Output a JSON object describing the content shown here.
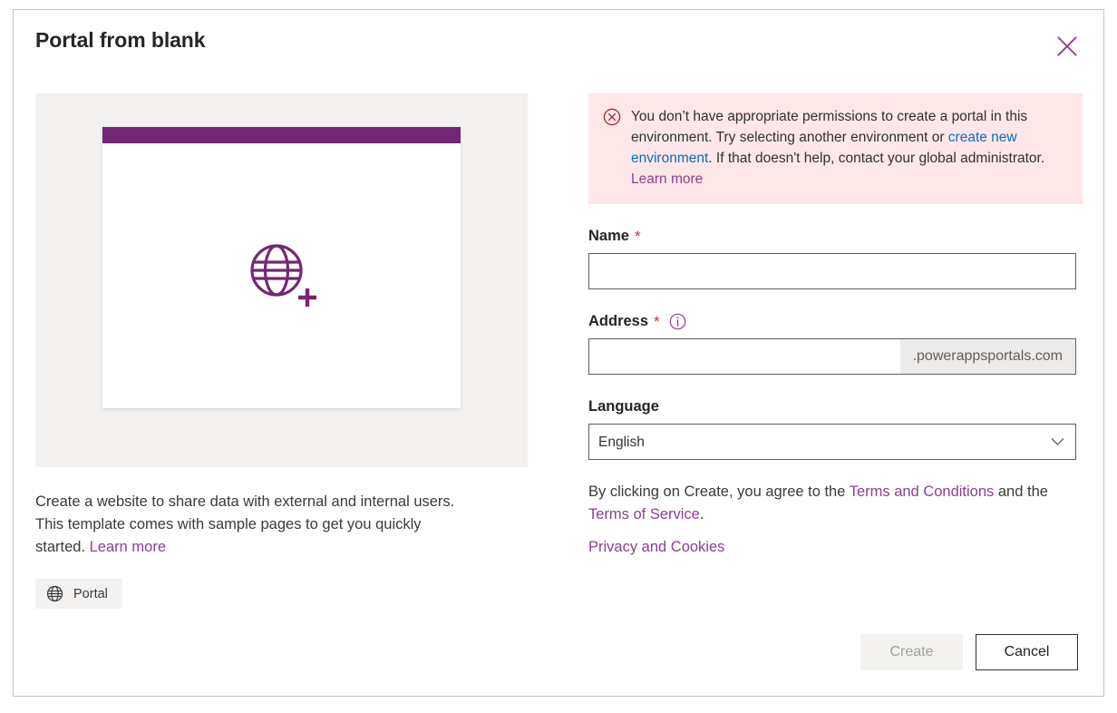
{
  "dialog": {
    "title": "Portal from blank",
    "close_icon": "close-icon"
  },
  "left_panel": {
    "preview": {
      "header_color": "#742774",
      "icon": "globe-plus-icon"
    },
    "description_part1": "Create a website to share data with external and internal users. This template comes with sample pages to get you quickly started. ",
    "description_link": "Learn more",
    "chip": {
      "icon": "globe-icon",
      "label": "Portal"
    }
  },
  "right_panel": {
    "error": {
      "icon": "error-circle-x-icon",
      "text_part1": "You don’t have appropriate permissions to create a portal in this environment. Try selecting another environment or ",
      "link_create_env": "create new environment",
      "text_part2": ". If that doesn't help, contact your global administrator. ",
      "link_learn_more": "Learn more",
      "background_color": "#fde7e9",
      "icon_color": "#a4262c",
      "link_color": "#0f6cbd"
    },
    "name_field": {
      "label": "Name",
      "required_marker": "*",
      "value": "",
      "placeholder": ""
    },
    "address_field": {
      "label": "Address",
      "required_marker": "*",
      "info_icon": "info-icon",
      "value": "",
      "placeholder": "",
      "suffix": ".powerappsportals.com"
    },
    "language_field": {
      "label": "Language",
      "selected": "English",
      "options": [
        "English"
      ],
      "chevron_icon": "chevron-down-icon"
    },
    "terms": {
      "text_part1": "By clicking on Create, you agree to the ",
      "link_terms_conditions": "Terms and Conditions",
      "text_part2": " and the ",
      "link_terms_service": "Terms of Service",
      "text_part3": ".",
      "link_privacy": "Privacy and Cookies"
    }
  },
  "footer": {
    "create_label": "Create",
    "cancel_label": "Cancel"
  },
  "theme": {
    "accent_purple": "#742774",
    "link_purple": "#8f3f8f",
    "link_blue": "#0f6cbd",
    "required_red": "#c4314b",
    "panel_gray": "#f3f2f1"
  }
}
